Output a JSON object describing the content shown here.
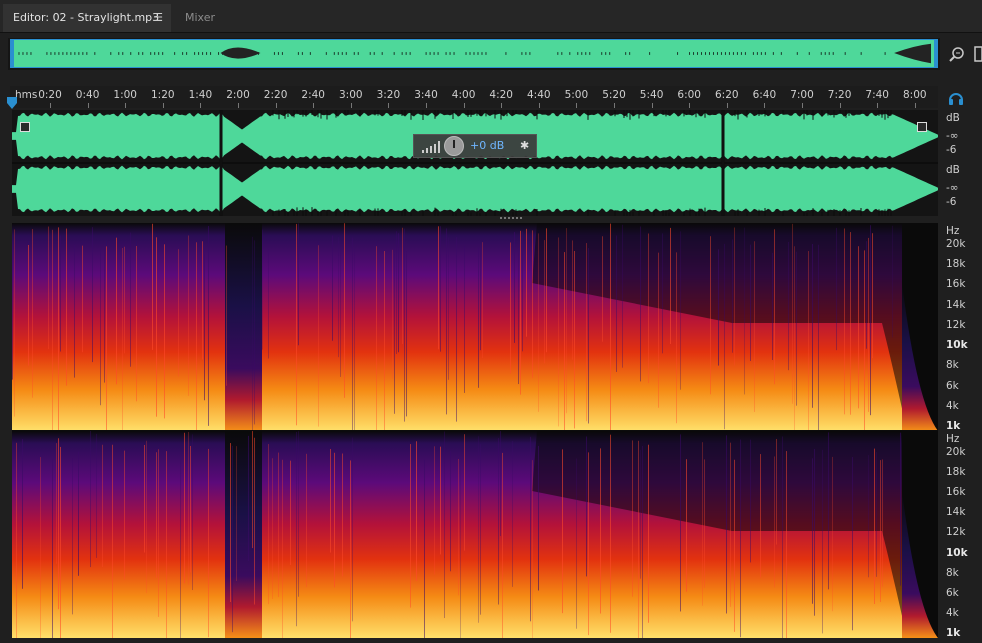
{
  "tabs": {
    "editor_label": "Editor: 02 - Straylight.mp3",
    "editor_menu_glyph": "☰",
    "mixer_label": "Mixer"
  },
  "ruler": {
    "unit": "hms",
    "labels": [
      "0:20",
      "0:40",
      "1:00",
      "1:20",
      "1:40",
      "2:00",
      "2:20",
      "2:40",
      "3:00",
      "3:20",
      "3:40",
      "4:00",
      "4:20",
      "4:40",
      "5:00",
      "5:20",
      "5:40",
      "6:00",
      "6:20",
      "6:40",
      "7:00",
      "7:20",
      "7:40",
      "8:00"
    ]
  },
  "hud": {
    "gain_label": "+0 dB",
    "pin_glyph": "✱"
  },
  "waveform_scale": {
    "channel_1": [
      "dB",
      "-∞",
      "-6"
    ],
    "channel_2": [
      "dB",
      "-∞",
      "-6"
    ]
  },
  "spectral_scale": {
    "channel_1": [
      "Hz",
      "20k",
      "18k",
      "16k",
      "14k",
      "12k",
      "10k",
      "8k",
      "6k",
      "4k",
      "1k"
    ],
    "channel_2": [
      "Hz",
      "20k",
      "18k",
      "16k",
      "14k",
      "12k",
      "10k",
      "8k",
      "6k",
      "4k",
      "1k"
    ]
  },
  "colors": {
    "waveform": "#4ed89a",
    "selection_border": "#2a8fd0",
    "accent": "#2a8fd0",
    "gain_text": "#6fb6ff"
  },
  "icons": {
    "zoom": "zoom-icon",
    "headphones": "headphones-icon",
    "pin": "pin-icon",
    "fade_in": "fade-in-handle",
    "fade_out": "fade-out-handle"
  }
}
